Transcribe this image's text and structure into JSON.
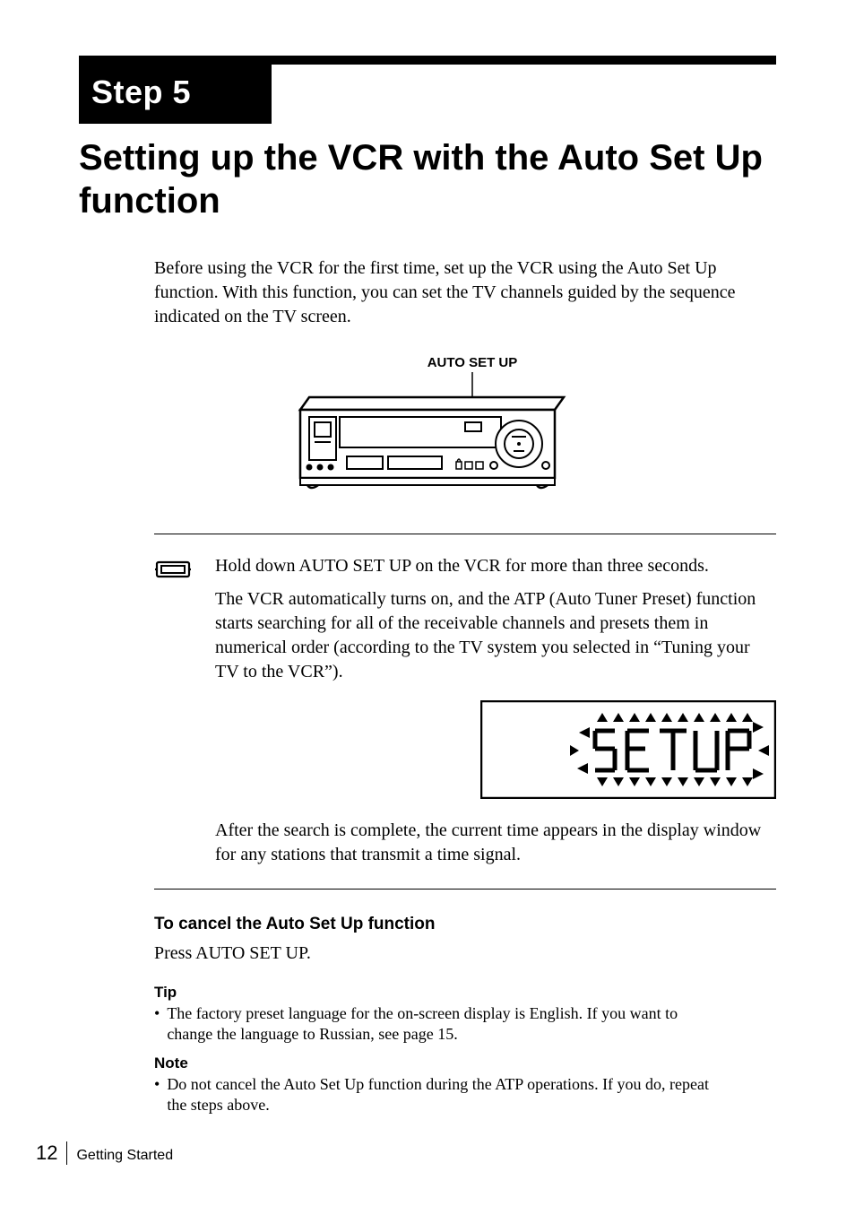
{
  "step_badge": "Step 5",
  "title": "Setting up the VCR with the Auto Set Up function",
  "intro": "Before using the VCR for the first time, set up the VCR using the Auto Set Up function.  With this function, you can set the TV channels guided by the sequence indicated on the TV screen.",
  "diagram": {
    "label": "AUTO SET UP"
  },
  "instructions": {
    "p1": "Hold down AUTO SET UP on the VCR for more than three seconds.",
    "p2": "The VCR automatically turns on, and the ATP (Auto Tuner Preset) function starts searching for all of the receivable channels and presets them in numerical order (according to the TV system you selected in “Tuning your TV to the VCR”).",
    "p3": "After the search is complete, the current time appears in the display window for any stations that transmit a time signal."
  },
  "display_text": "SETUP",
  "cancel": {
    "heading": "To cancel the Auto Set Up function",
    "body": "Press AUTO SET UP."
  },
  "tip": {
    "heading": "Tip",
    "bullet": "The factory preset language for the on-screen display is English.  If you want to change the language to Russian, see page 15."
  },
  "note": {
    "heading": "Note",
    "bullet": "Do not cancel the Auto Set Up function during the ATP operations.  If you do, repeat the steps above."
  },
  "footer": {
    "page": "12",
    "section": "Getting Started"
  }
}
